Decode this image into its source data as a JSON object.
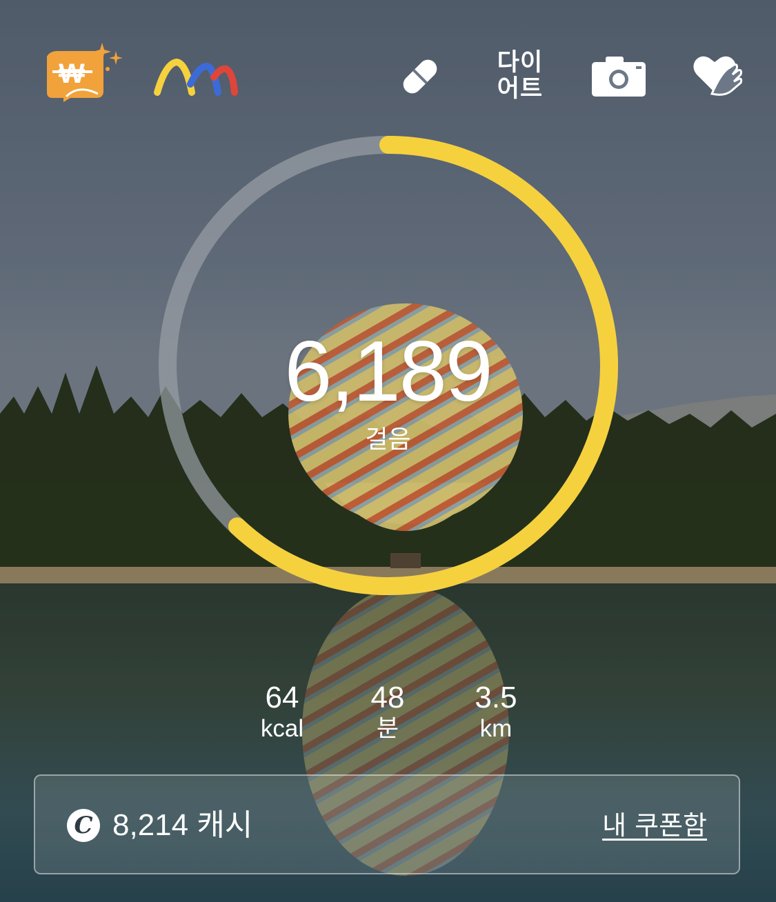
{
  "header": {
    "diet_label_line1": "다이",
    "diet_label_line2": "어트",
    "icons": [
      "won-cash-icon",
      "walk-logo-icon",
      "pill-icon",
      "camera-icon",
      "heart-hand-icon"
    ]
  },
  "steps": {
    "count": "6,189",
    "label": "걸음",
    "progress": 0.62
  },
  "stats": {
    "calories": {
      "value": "64",
      "unit": "kcal"
    },
    "minutes": {
      "value": "48",
      "unit": "분"
    },
    "distance": {
      "value": "3.5",
      "unit": "km"
    }
  },
  "cash": {
    "icon_letter": "C",
    "amount": "8,214 캐시",
    "coupon_link": "내 쿠폰함"
  },
  "colors": {
    "accent": "#F6D13E",
    "ring_track": "#9AA0A6",
    "won_orange": "#F1A23A"
  }
}
